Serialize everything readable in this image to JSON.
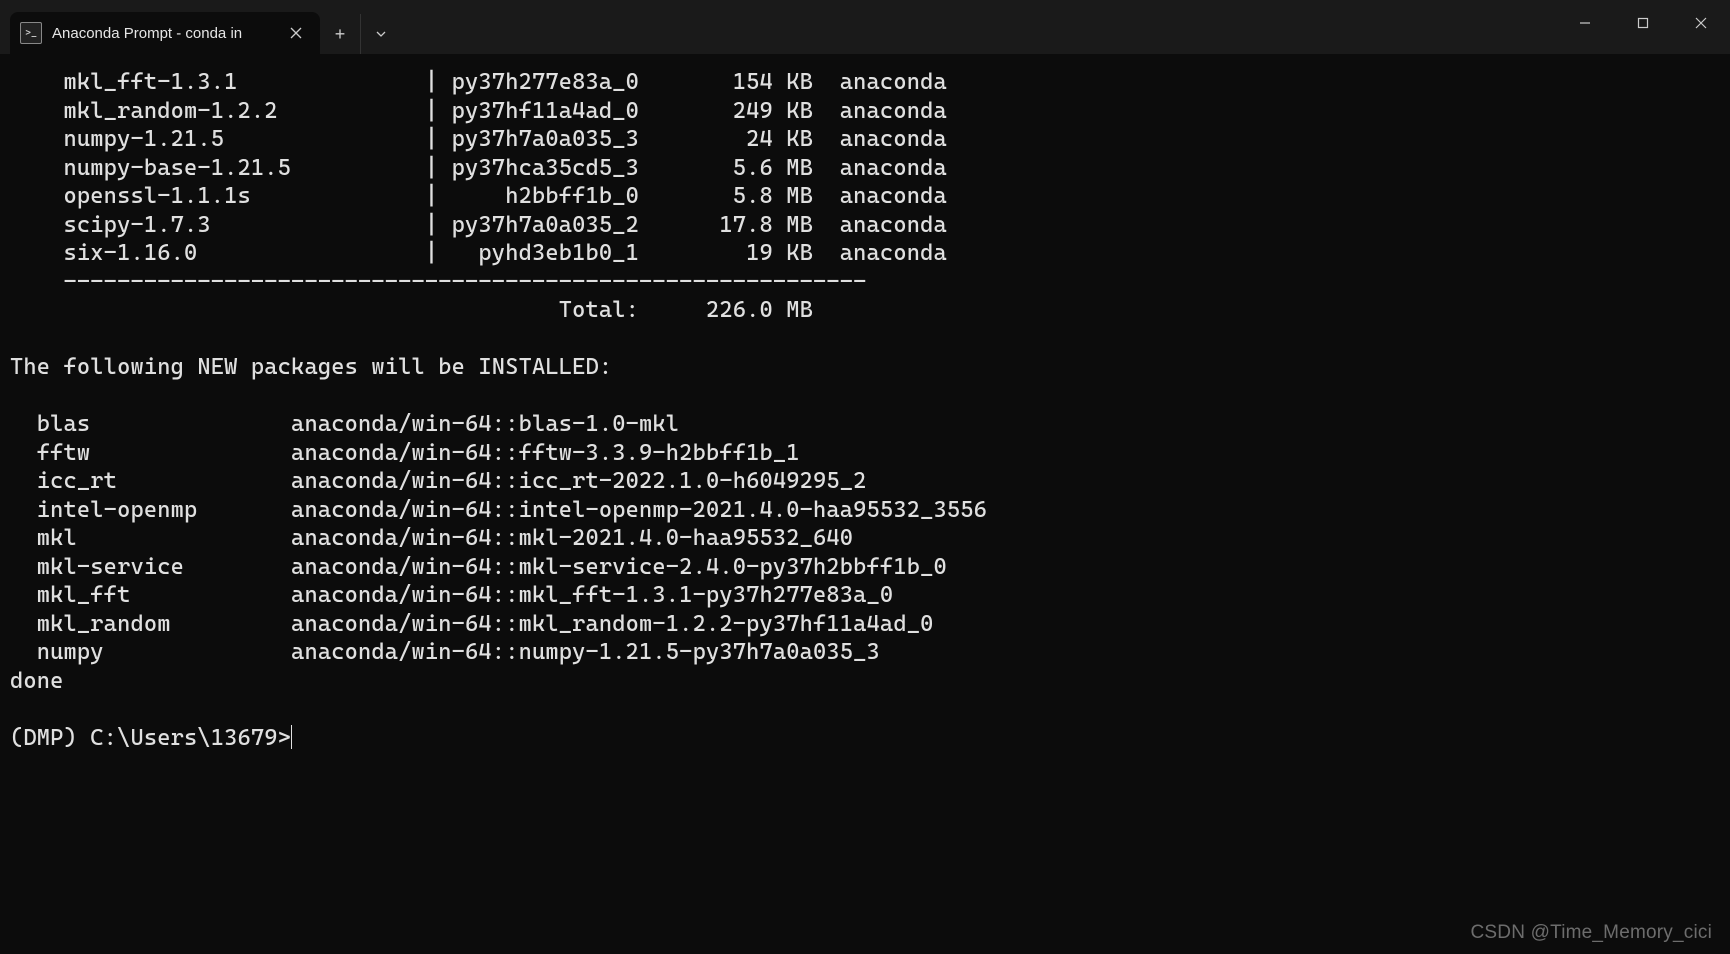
{
  "titlebar": {
    "tab_title": "Anaconda Prompt - conda  in",
    "tab_icon_text": ">_"
  },
  "download_table": {
    "rows": [
      {
        "name": "mkl_fft-1.3.1",
        "build": "py37h277e83a_0",
        "size": "154 KB",
        "channel": "anaconda"
      },
      {
        "name": "mkl_random-1.2.2",
        "build": "py37hf11a4ad_0",
        "size": "249 KB",
        "channel": "anaconda"
      },
      {
        "name": "numpy-1.21.5",
        "build": "py37h7a0a035_3",
        "size": "24 KB",
        "channel": "anaconda"
      },
      {
        "name": "numpy-base-1.21.5",
        "build": "py37hca35cd5_3",
        "size": "5.6 MB",
        "channel": "anaconda"
      },
      {
        "name": "openssl-1.1.1s",
        "build": "h2bbff1b_0",
        "size": "5.8 MB",
        "channel": "anaconda"
      },
      {
        "name": "scipy-1.7.3",
        "build": "py37h7a0a035_2",
        "size": "17.8 MB",
        "channel": "anaconda"
      },
      {
        "name": "six-1.16.0",
        "build": "pyhd3eb1b0_1",
        "size": "19 KB",
        "channel": "anaconda"
      }
    ],
    "separator": "    ------------------------------------------------------------",
    "total_label": "Total:",
    "total_size": "226.0 MB"
  },
  "install_header": "The following NEW packages will be INSTALLED:",
  "install_list": [
    {
      "name": "blas",
      "spec": "anaconda/win-64::blas-1.0-mkl"
    },
    {
      "name": "fftw",
      "spec": "anaconda/win-64::fftw-3.3.9-h2bbff1b_1"
    },
    {
      "name": "icc_rt",
      "spec": "anaconda/win-64::icc_rt-2022.1.0-h6049295_2"
    },
    {
      "name": "intel-openmp",
      "spec": "anaconda/win-64::intel-openmp-2021.4.0-haa95532_3556"
    },
    {
      "name": "mkl",
      "spec": "anaconda/win-64::mkl-2021.4.0-haa95532_640"
    },
    {
      "name": "mkl-service",
      "spec": "anaconda/win-64::mkl-service-2.4.0-py37h2bbff1b_0"
    },
    {
      "name": "mkl_fft",
      "spec": "anaconda/win-64::mkl_fft-1.3.1-py37h277e83a_0"
    },
    {
      "name": "mkl_random",
      "spec": "anaconda/win-64::mkl_random-1.2.2-py37hf11a4ad_0"
    },
    {
      "name": "numpy",
      "spec": "anaconda/win-64::numpy-1.21.5-py37h7a0a035_3"
    }
  ],
  "done_line": "done",
  "prompt": "(DMP) C:\\Users\\13679>",
  "watermark": "CSDN @Time_Memory_cici"
}
